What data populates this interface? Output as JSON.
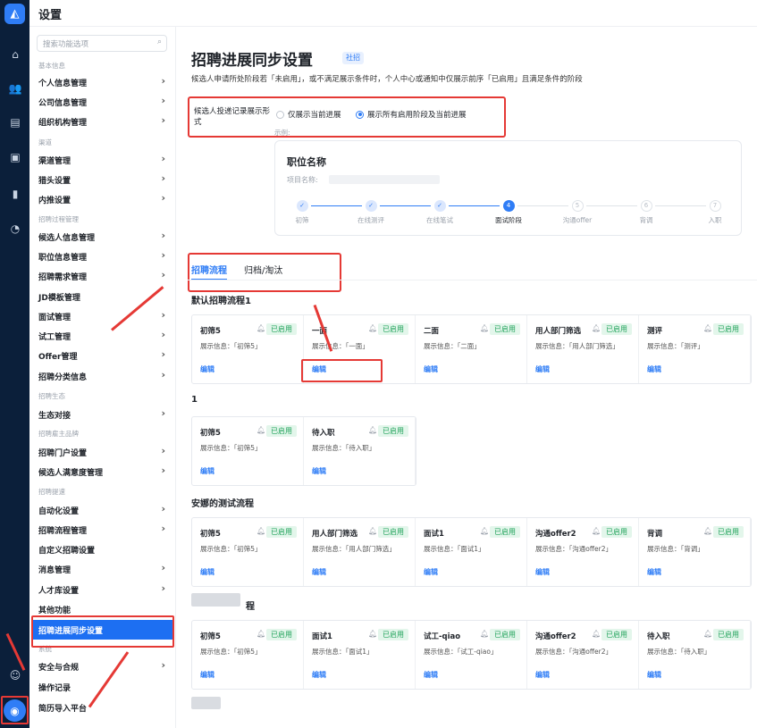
{
  "topbar": {
    "title": "设置"
  },
  "rail": {
    "icons": [
      "home-icon",
      "users-icon",
      "briefcase-icon",
      "lock-icon",
      "book-icon",
      "chart-icon"
    ],
    "bottom": [
      "feedback-icon",
      "settings-icon"
    ]
  },
  "sidebar": {
    "search_placeholder": "搜索功能选项",
    "groups": {
      "basic": "基本信息",
      "channel": "渠道",
      "process": "招聘过程管理",
      "eco": "招聘生态",
      "employer": "招聘雇主品牌",
      "boost": "招聘提速",
      "system": "系统"
    },
    "items": {
      "personal": "个人信息管理",
      "company": "公司信息管理",
      "org": "组织机构管理",
      "channel": "渠道管理",
      "headhunter": "猎头设置",
      "referral": "内推设置",
      "candidate": "候选人信息管理",
      "position": "职位信息管理",
      "demand": "招聘需求管理",
      "jd": "JD模板管理",
      "interview": "面试管理",
      "trial": "试工管理",
      "offer": "Offer管理",
      "category": "招聘分类信息",
      "ecosystem": "生态对接",
      "portal": "招聘门户设置",
      "satisfaction": "候选人满意度管理",
      "automation": "自动化设置",
      "flow": "招聘流程管理",
      "custom": "自定义招聘设置",
      "message": "消息管理",
      "talent": "人才库设置",
      "other": "其他功能",
      "sync": "招聘进展同步设置",
      "security": "安全与合规",
      "log": "操作记录",
      "resume": "简历导入平台"
    }
  },
  "main": {
    "title": "招聘进展同步设置",
    "tag": "社招",
    "desc": "候选人申请所处阶段若「未启用」，或不满足展示条件时，个人中心或通知中仅展示前序「已启用」且满足条件的阶段",
    "setting_label": "候选人投递记录展示形式",
    "option1": "仅展示当前进展",
    "option2": "展示所有启用阶段及当前进展",
    "example": "示例:",
    "preview": {
      "title": "职位名称",
      "item_label": "项目名称:",
      "steps": [
        {
          "label": "初筛",
          "mark": "✓",
          "state": "done"
        },
        {
          "label": "在线测评",
          "mark": "✓",
          "state": "done"
        },
        {
          "label": "在线笔试",
          "mark": "✓",
          "state": "done"
        },
        {
          "label": "面试阶段",
          "mark": "4",
          "state": "cur"
        },
        {
          "label": "沟通offer",
          "mark": "5",
          "state": "todo"
        },
        {
          "label": "背调",
          "mark": "6",
          "state": "todo"
        },
        {
          "label": "入职",
          "mark": "7",
          "state": "todo"
        }
      ]
    },
    "tabs": [
      "招聘流程",
      "归档/淘汰"
    ],
    "enabled": "已启用",
    "edit": "编辑",
    "info_prefix": "展示信息：",
    "flows": [
      {
        "title": "默认招聘流程1",
        "cards": [
          [
            "初筛5",
            "「初筛5」"
          ],
          [
            "一面",
            "「一面」"
          ],
          [
            "二面",
            "「二面」"
          ],
          [
            "用人部门筛选",
            "「用人部门筛选」"
          ],
          [
            "测评",
            "「测评」"
          ]
        ]
      },
      {
        "title": "1",
        "cards": [
          [
            "初筛5",
            "「初筛5」"
          ],
          [
            "待入职",
            "「待入职」"
          ]
        ]
      },
      {
        "title": "安娜的测试流程",
        "cards": [
          [
            "初筛5",
            "「初筛5」"
          ],
          [
            "用人部门筛选",
            "「用人部门筛选」"
          ],
          [
            "面试1",
            "「面试1」"
          ],
          [
            "沟通offer2",
            "「沟通offer2」"
          ],
          [
            "背调",
            "「背调」"
          ]
        ]
      },
      {
        "title": "程",
        "cards": [
          [
            "初筛5",
            "「初筛5」"
          ],
          [
            "面试1",
            "「面试1」"
          ],
          [
            "试工-qiao",
            "「试工-qiao」"
          ],
          [
            "沟通offer2",
            "「沟通offer2」"
          ],
          [
            "待入职",
            "「待入职」"
          ]
        ]
      }
    ]
  }
}
